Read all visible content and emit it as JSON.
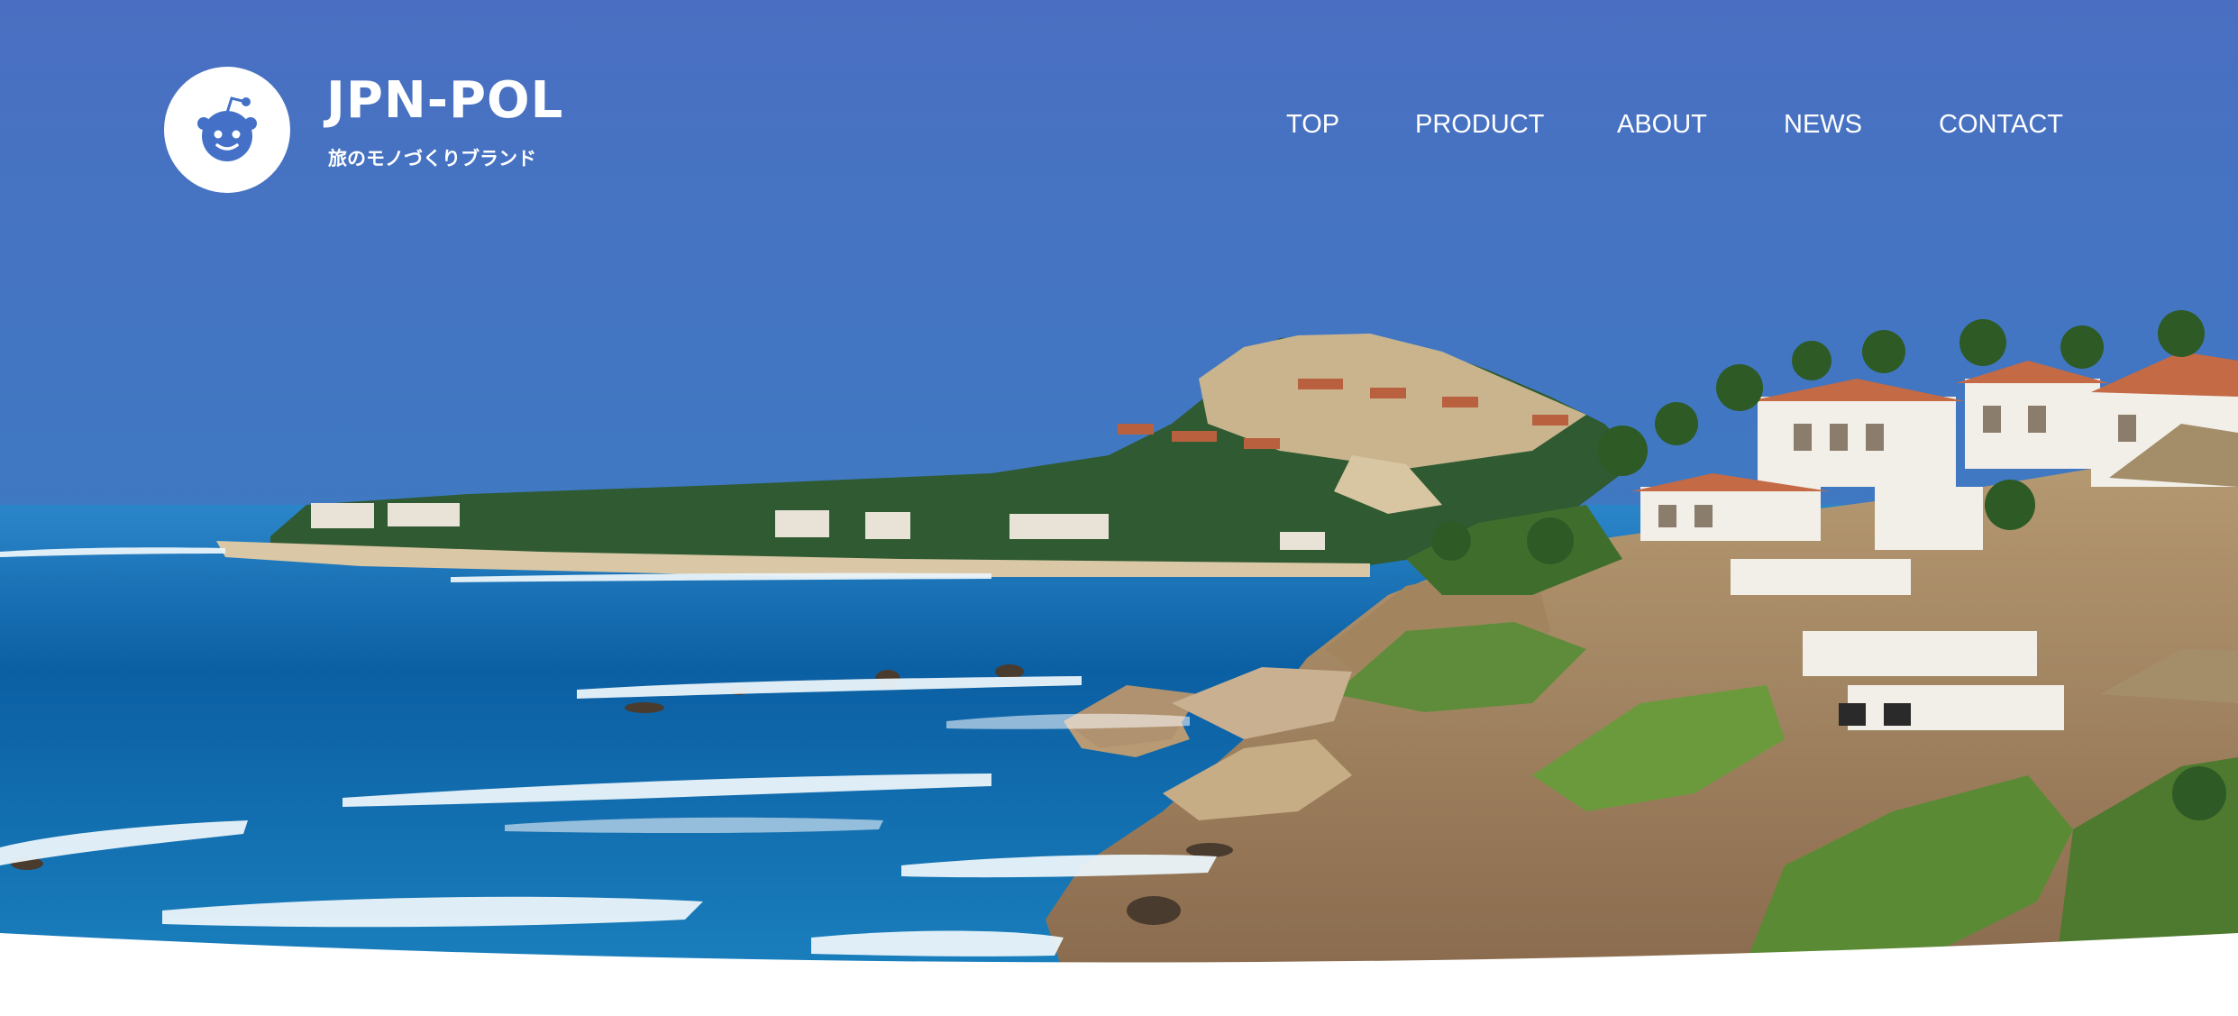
{
  "brand": {
    "name": "JPN-POL",
    "tagline": "旅のモノづくりブランド",
    "logo_icon": "reddit-alien-icon"
  },
  "nav": {
    "items": [
      {
        "label": "TOP"
      },
      {
        "label": "PRODUCT"
      },
      {
        "label": "ABOUT"
      },
      {
        "label": "NEWS"
      },
      {
        "label": "CONTACT"
      }
    ]
  },
  "colors": {
    "sky_top": "#4a6fc2",
    "sky_horizon": "#3f78c0",
    "sea_deep": "#0a5fa0",
    "sea_light": "#1f8fc8",
    "foam": "#eaf4fa",
    "text_on_hero": "#ffffff"
  }
}
